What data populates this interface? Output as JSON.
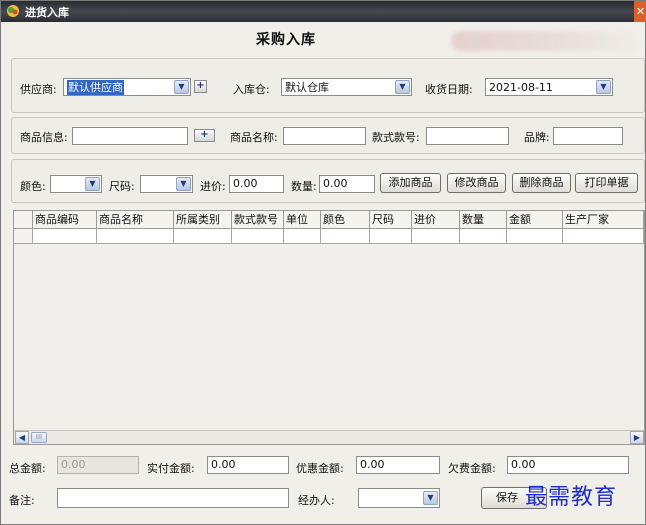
{
  "window": {
    "title": "进货入库",
    "close_glyph": "✕"
  },
  "heading": "采购入库",
  "row1": {
    "supplier_label": "供应商:",
    "supplier_value": "默认供应商",
    "warehouse_label": "入库仓:",
    "warehouse_value": "默认仓库",
    "date_label": "收货日期:",
    "date_value": "2021-08-11"
  },
  "row2": {
    "product_info_label": "商品信息:",
    "product_info_value": "",
    "product_name_label": "商品名称:",
    "product_name_value": "",
    "style_no_label": "款式款号:",
    "style_no_value": "",
    "brand_label": "品牌:",
    "brand_value": ""
  },
  "row3": {
    "color_label": "颜色:",
    "color_value": "",
    "size_label": "尺码:",
    "size_value": "",
    "price_label": "进价:",
    "price_value": "0.00",
    "qty_label": "数量:",
    "qty_value": "0.00",
    "add_label": "添加商品",
    "edit_label": "修改商品",
    "delete_label": "删除商品",
    "print_label": "打印单据"
  },
  "grid": {
    "columns": [
      "",
      "商品编码",
      "商品名称",
      "所属类别",
      "款式款号",
      "单位",
      "颜色",
      "尺码",
      "进价",
      "数量",
      "金额",
      "生产厂家"
    ],
    "scroll_thumb_glyph": "III"
  },
  "footer": {
    "total_label": "总金额:",
    "total_value": "0.00",
    "paid_label": "实付金额:",
    "paid_value": "0.00",
    "discount_label": "优惠金额:",
    "discount_value": "0.00",
    "owed_label": "欠费金额:",
    "owed_value": "0.00",
    "remark_label": "备注:",
    "remark_value": "",
    "handler_label": "经办人:",
    "handler_value": "",
    "save_label": "保存"
  },
  "watermark": "最需教育",
  "icons": {
    "app": "app-icon",
    "close": "close-icon",
    "dropdown": "chevron-down-icon",
    "add": "plus-icon",
    "scroll_left": "arrow-left-icon",
    "scroll_right": "arrow-right-icon"
  }
}
